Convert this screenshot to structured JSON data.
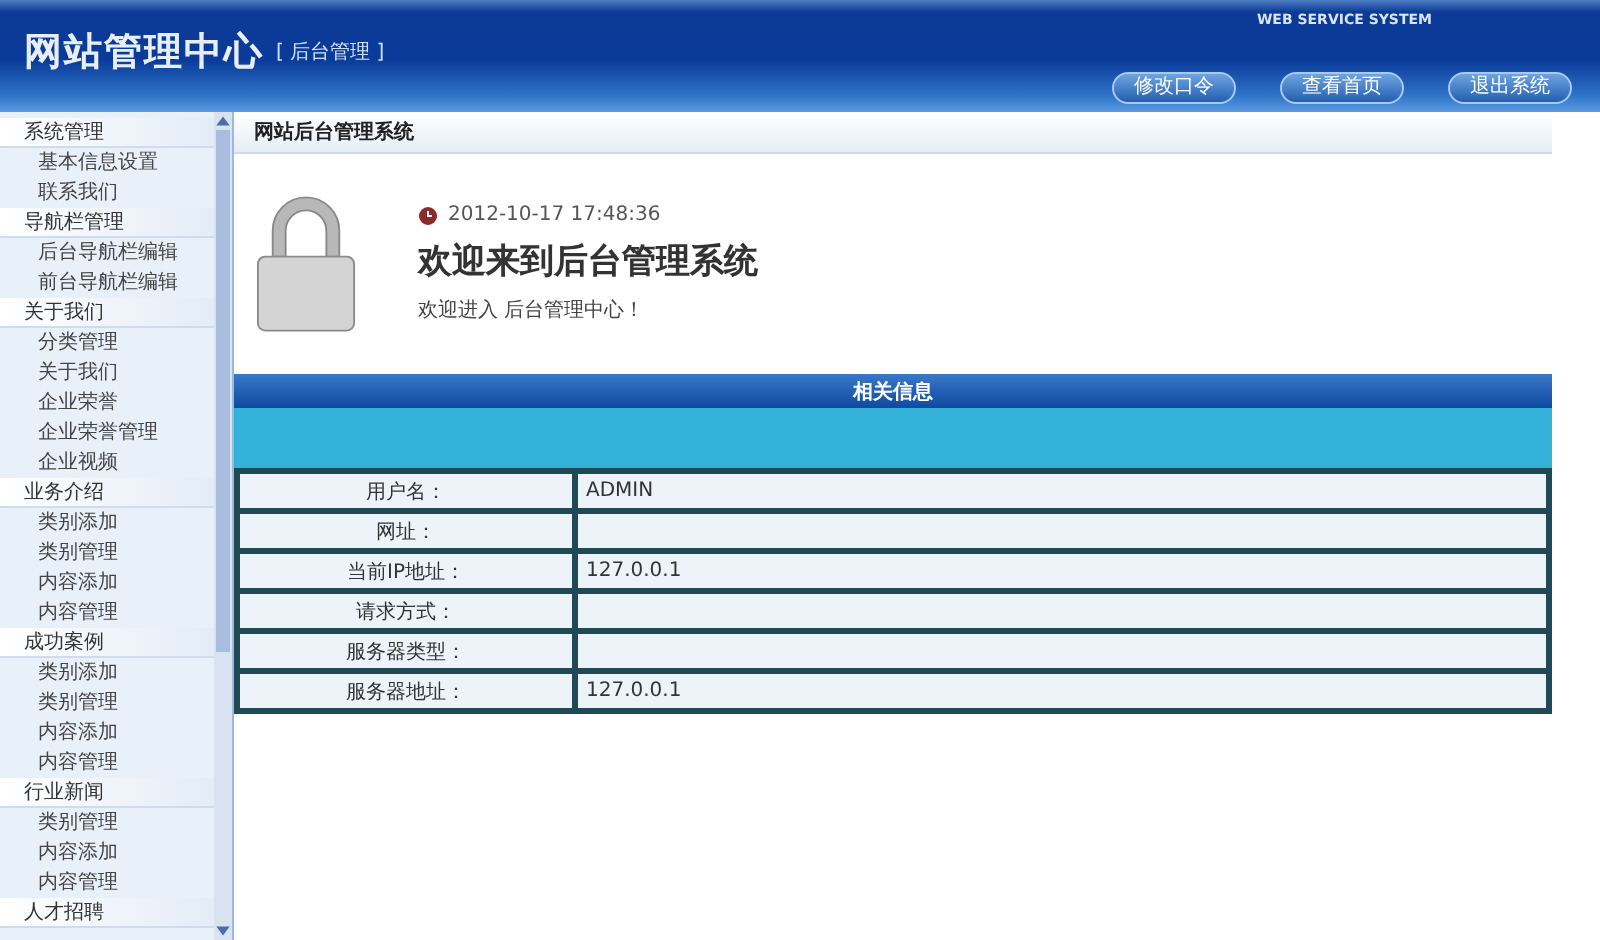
{
  "header": {
    "title": "网站管理中心",
    "subtitle": "[ 后台管理 ]",
    "tagline": "WEB SERVICE SYSTEM",
    "buttons": [
      "修改口令",
      "查看首页",
      "退出系统"
    ]
  },
  "sidebar": {
    "groups": [
      {
        "label": "系统管理",
        "items": [
          "基本信息设置",
          "联系我们"
        ]
      },
      {
        "label": "导航栏管理",
        "items": [
          "后台导航栏编辑",
          "前台导航栏编辑"
        ]
      },
      {
        "label": "关于我们",
        "items": [
          "分类管理",
          "关于我们",
          "企业荣誉",
          "企业荣誉管理",
          "企业视频"
        ]
      },
      {
        "label": "业务介绍",
        "items": [
          "类别添加",
          "类别管理",
          "内容添加",
          "内容管理"
        ]
      },
      {
        "label": "成功案例",
        "items": [
          "类别添加",
          "类别管理",
          "内容添加",
          "内容管理"
        ]
      },
      {
        "label": "行业新闻",
        "items": [
          "类别管理",
          "内容添加",
          "内容管理"
        ]
      },
      {
        "label": "人才招聘"
      }
    ]
  },
  "breadcrumb": "网站后台管理系统",
  "welcome": {
    "datetime": "2012-10-17 17:48:36",
    "heading": "欢迎来到后台管理系统",
    "message": "欢迎进入 后台管理中心！"
  },
  "info_panel": {
    "title": "相关信息",
    "rows": [
      {
        "label": "用户名：",
        "value": "ADMIN"
      },
      {
        "label": "网址："
      },
      {
        "label": "当前IP地址：",
        "value": "127.0.0.1"
      },
      {
        "label": "请求方式："
      },
      {
        "label": "服务器类型："
      },
      {
        "label": "服务器地址：",
        "value": "127.0.0.1"
      }
    ]
  }
}
